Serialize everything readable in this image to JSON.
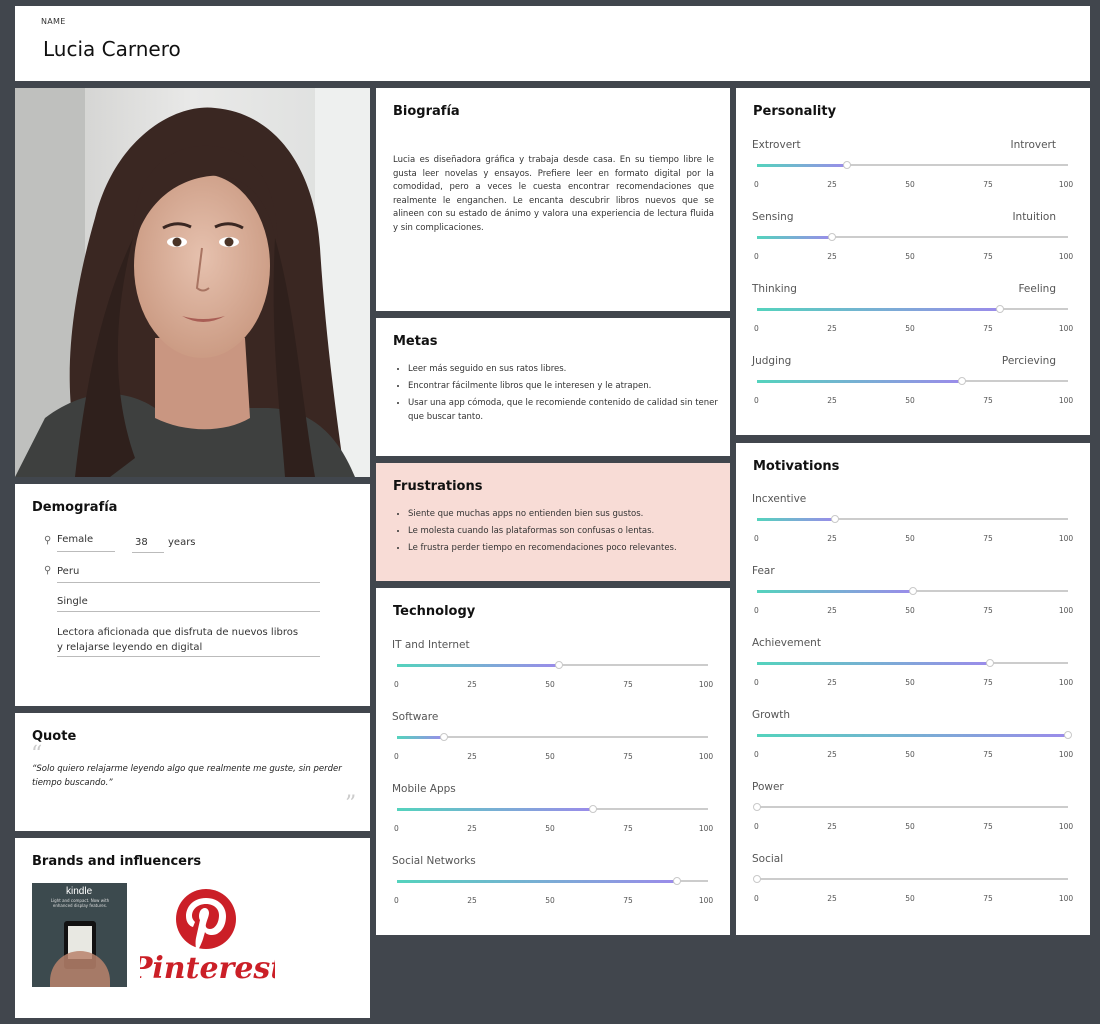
{
  "header": {
    "label": "NAME",
    "name": "Lucia Carnero"
  },
  "demographics": {
    "title": "Demografía",
    "gender": "Female",
    "age": "38",
    "age_unit": "years",
    "location": "Peru",
    "status": "Single",
    "description": "Lectora aficionada que disfruta de nuevos libros y relajarse leyendo en digital"
  },
  "quote": {
    "title": "Quote",
    "text": "“Solo quiero relajarme leyendo algo que realmente me guste, sin perder tiempo buscando.”"
  },
  "brands": {
    "title": "Brands and influencers",
    "items": [
      "kindle",
      "Pinterest"
    ],
    "kindle_tagline": "Light and compact. Now with enhanced display features."
  },
  "bio": {
    "title": "Biografía",
    "text": "Lucia es diseñadora gráfica y trabaja desde casa. En su tiempo libre le gusta leer novelas y ensayos. Prefiere leer en formato digital por la comodidad, pero a veces le cuesta encontrar recomendaciones que realmente le enganchen. Le encanta descubrir libros nuevos que se alineen con su estado de ánimo y valora una experiencia de lectura fluida y sin complicaciones."
  },
  "goals": {
    "title": "Metas",
    "items": [
      "Leer más seguido en sus ratos libres.",
      "Encontrar fácilmente libros que le interesen y le atrapen.",
      "Usar una app cómoda, que le recomiende contenido de calidad sin tener que buscar tanto."
    ]
  },
  "frustrations": {
    "title": "Frustrations",
    "items": [
      "Siente que muchas apps no entienden bien sus gustos.",
      "Le molesta cuando las plataformas son confusas o lentas.",
      "Le frustra perder tiempo en recomendaciones poco relevantes."
    ]
  },
  "ticks": [
    "0",
    "25",
    "50",
    "75",
    "100"
  ],
  "technology": {
    "title": "Technology",
    "sliders": [
      {
        "left": "IT and Internet",
        "value": 52
      },
      {
        "left": "Software",
        "value": 15
      },
      {
        "left": "Mobile Apps",
        "value": 63
      },
      {
        "left": "Social Networks",
        "value": 90
      }
    ]
  },
  "personality": {
    "title": "Personality",
    "sliders": [
      {
        "left": "Extrovert",
        "right": "Introvert",
        "value": 29
      },
      {
        "left": "Sensing",
        "right": "Intuition",
        "value": 24
      },
      {
        "left": "Thinking",
        "right": "Feeling",
        "value": 78
      },
      {
        "left": "Judging",
        "right": "Percieving",
        "value": 66
      }
    ]
  },
  "motivations": {
    "title": "Motivations",
    "sliders": [
      {
        "left": "Incxentive",
        "value": 25
      },
      {
        "left": "Fear",
        "value": 50
      },
      {
        "left": "Achievement",
        "value": 75
      },
      {
        "left": "Growth",
        "value": 100
      },
      {
        "left": "Power",
        "value": 0
      },
      {
        "left": "Social",
        "value": 0
      }
    ]
  },
  "colors": {
    "background": "#41464d",
    "frustrations_bg": "#f8dcd6",
    "slider_start": "#54d3bd",
    "slider_end": "#9b8bea",
    "pinterest_red": "#cb1f27"
  }
}
